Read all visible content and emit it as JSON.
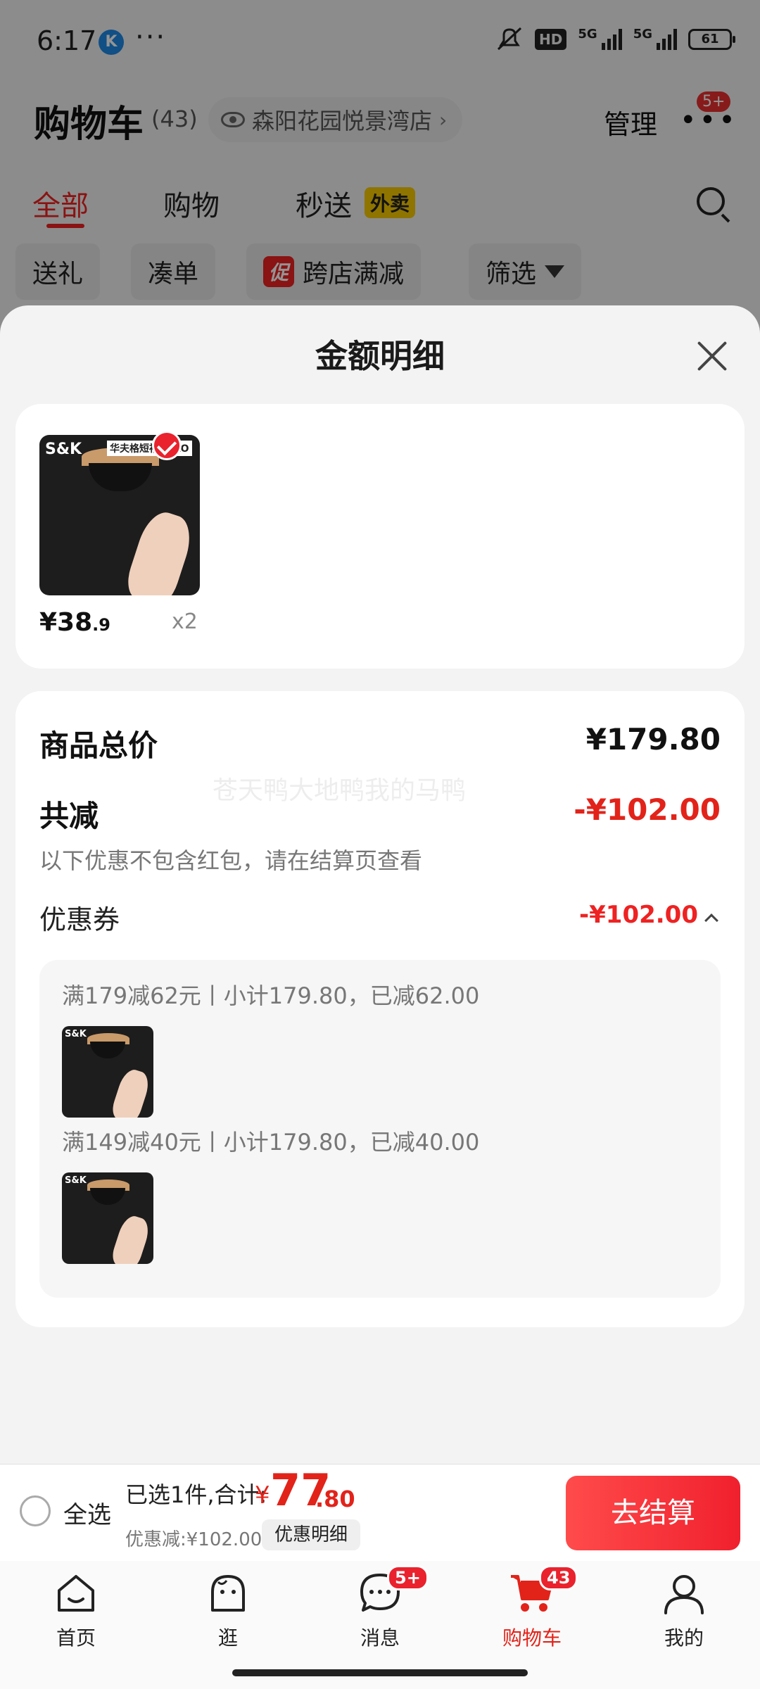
{
  "status_bar": {
    "time": "6:17",
    "app_badge": "K",
    "dots": "···",
    "hd": "HD",
    "net1": "5G",
    "net2": "5G",
    "battery": "61"
  },
  "header": {
    "title": "购物车",
    "count": "(43)",
    "store": "森阳花园悦景湾店",
    "manage": "管理",
    "more_badge": "5+"
  },
  "tabs": [
    {
      "label": "全部"
    },
    {
      "label": "购物"
    },
    {
      "label": "秒送"
    }
  ],
  "tab_tag": "外卖",
  "filters": [
    {
      "label": "送礼"
    },
    {
      "label": "凑单"
    },
    {
      "label": "跨店满减",
      "badge": "促"
    },
    {
      "label": "筛选"
    }
  ],
  "sheet": {
    "title": "金额明细",
    "item": {
      "price_main": "¥38",
      "price_dec": ".9",
      "qty": "x2",
      "brand": "S&K",
      "tagline": "华夫格短袖POLO"
    },
    "summary": {
      "total_label": "商品总价",
      "total_value": "¥179.80",
      "discount_label": "共减",
      "discount_value": "-¥102.00",
      "note": "以下优惠不包含红包，请在结算页查看",
      "watermark": "苍天鸭大地鸭我的马鸭",
      "coupon_label": "优惠券",
      "coupon_value": "-¥102.00"
    },
    "coupons": [
      {
        "rule": "满179减62元丨小计179.80，已减62.00"
      },
      {
        "rule": "满149减40元丨小计179.80，已减40.00"
      }
    ]
  },
  "checkout": {
    "select_all": "全选",
    "selected_text": "已选1件,合计:",
    "currency": "¥",
    "total_int": "77",
    "total_dec": ".80",
    "discount_text": "优惠减:¥102.00",
    "detail_button": "优惠明细",
    "checkout_button": "去结算"
  },
  "nav": [
    {
      "label": "首页",
      "icon": "home-icon"
    },
    {
      "label": "逛",
      "icon": "browse-icon"
    },
    {
      "label": "消息",
      "icon": "message-icon",
      "badge": "5+"
    },
    {
      "label": "购物车",
      "icon": "cart-icon",
      "badge": "43",
      "active": true
    },
    {
      "label": "我的",
      "icon": "profile-icon"
    }
  ],
  "colors": {
    "accent": "#e2231a",
    "overlay": "rgba(0,0,0,0.42)",
    "sheet_bg": "#f3f3f3"
  }
}
